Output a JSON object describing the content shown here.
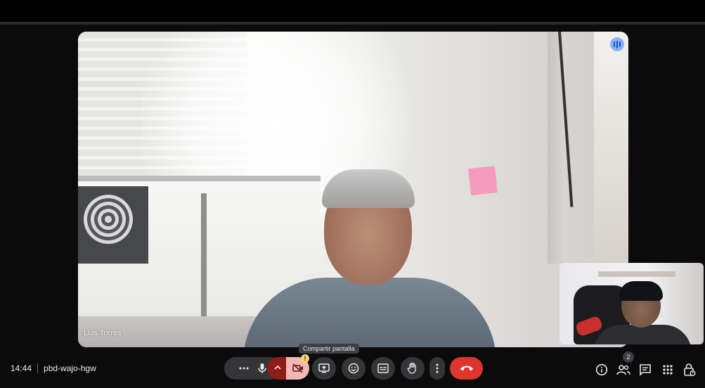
{
  "meeting": {
    "time": "14:44",
    "code": "pbd-wajo-hgw"
  },
  "main_video": {
    "participant_name": "Luis Torres"
  },
  "people": {
    "count": "2"
  },
  "controls": {
    "share_tooltip": "Compartir pantalla"
  },
  "icons": {
    "pin": "audio-level-icon",
    "more_left": "more-horizontal-icon",
    "mic": "microphone-icon",
    "camera_options": "chevron-up-icon",
    "camera_off": "camera-off-icon",
    "warning": "warning-icon",
    "share": "present-screen-icon",
    "emoji": "emoji-icon",
    "captions": "captions-icon",
    "hand": "raise-hand-icon",
    "more": "more-vertical-icon",
    "leave": "end-call-icon",
    "info": "info-icon",
    "people": "people-icon",
    "chat": "chat-icon",
    "activities": "apps-grid-icon",
    "host_controls": "lock-person-icon"
  },
  "colors": {
    "leave_button": "#dc362e",
    "camera_off_bg": "#8c1d18",
    "camera_off_active": "#f2b8b5",
    "pin_button": "#8ab4f8",
    "warning": "#fdd663"
  }
}
